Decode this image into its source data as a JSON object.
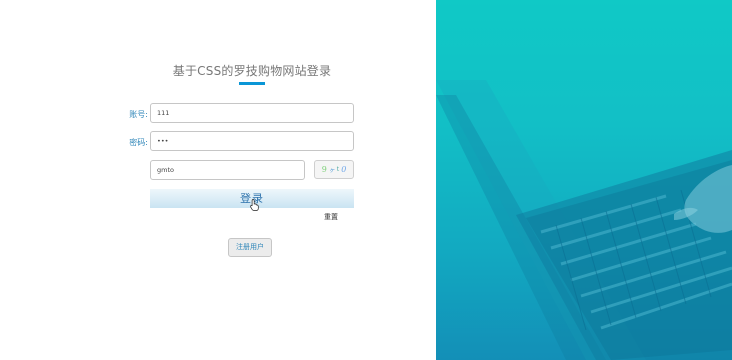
{
  "login": {
    "title": "基于CSS的罗技购物网站登录",
    "username_label": "账号:",
    "username_value": "111",
    "password_label": "密码:",
    "password_value": "•••",
    "captcha_input_value": "gmto",
    "captcha_chars": [
      "9",
      "ヶ",
      "t",
      "0"
    ],
    "login_button": "登录",
    "reset_link": "重置",
    "register_button": "注册用户"
  },
  "colors": {
    "accent": "#0a96d6",
    "label": "#2f86b8",
    "panel_gradient_top": "#10c9c6",
    "panel_gradient_bottom": "#138fb7"
  },
  "icons": {
    "cursor": "hand-pointer-icon"
  }
}
